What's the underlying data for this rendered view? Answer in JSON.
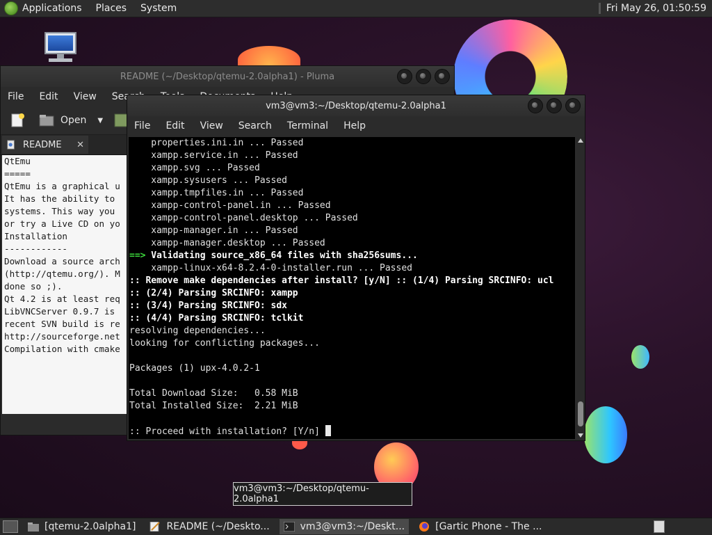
{
  "top_panel": {
    "menus": [
      "Applications",
      "Places",
      "System"
    ],
    "clock": "Fri May 26, 01:50:59"
  },
  "pluma": {
    "title": "README (~/Desktop/qtemu-2.0alpha1) - Pluma",
    "menus": [
      "File",
      "Edit",
      "View",
      "Search",
      "Tools",
      "Documents",
      "Help"
    ],
    "toolbar": {
      "open_label": "Open"
    },
    "tab_label": "README",
    "text_lines": [
      "QtEmu",
      "=====",
      "",
      "QtEmu is a graphical u",
      "It has the ability to",
      "systems. This way you",
      "or try a Live CD on yo",
      "",
      "Installation",
      "------------",
      "Download a source arch",
      "(http://qtemu.org/). M",
      "done so ;).",
      "",
      "Qt 4.2 is at least req",
      "",
      "LibVNCServer 0.9.7 is",
      "recent SVN build is re",
      "http://sourceforge.net",
      "",
      "Compilation with cmake"
    ]
  },
  "terminal": {
    "title": "vm3@vm3:~/Desktop/qtemu-2.0alpha1",
    "menus": [
      "File",
      "Edit",
      "View",
      "Search",
      "Terminal",
      "Help"
    ],
    "lines": [
      {
        "prefix": "",
        "text": "    properties.ini.in ... Passed",
        "bold": false
      },
      {
        "prefix": "",
        "text": "    xampp.service.in ... Passed",
        "bold": false
      },
      {
        "prefix": "",
        "text": "    xampp.svg ... Passed",
        "bold": false
      },
      {
        "prefix": "",
        "text": "    xampp.sysusers ... Passed",
        "bold": false
      },
      {
        "prefix": "",
        "text": "    xampp.tmpfiles.in ... Passed",
        "bold": false
      },
      {
        "prefix": "",
        "text": "    xampp-control-panel.in ... Passed",
        "bold": false
      },
      {
        "prefix": "",
        "text": "    xampp-control-panel.desktop ... Passed",
        "bold": false
      },
      {
        "prefix": "",
        "text": "    xampp-manager.in ... Passed",
        "bold": false
      },
      {
        "prefix": "",
        "text": "    xampp-manager.desktop ... Passed",
        "bold": false
      },
      {
        "prefix": "==>",
        "text": " Validating source_x86_64 files with sha256sums...",
        "bold": true
      },
      {
        "prefix": "",
        "text": "    xampp-linux-x64-8.2.4-0-installer.run ... Passed",
        "bold": false
      },
      {
        "prefix": "",
        "text": ":: Remove make dependencies after install? [y/N] :: (1/4) Parsing SRCINFO: ucl",
        "bold": true
      },
      {
        "prefix": "",
        "text": ":: (2/4) Parsing SRCINFO: xampp",
        "bold": true
      },
      {
        "prefix": "",
        "text": ":: (3/4) Parsing SRCINFO: sdx",
        "bold": true
      },
      {
        "prefix": "",
        "text": ":: (4/4) Parsing SRCINFO: tclkit",
        "bold": true
      },
      {
        "prefix": "",
        "text": "resolving dependencies...",
        "bold": false
      },
      {
        "prefix": "",
        "text": "looking for conflicting packages...",
        "bold": false
      },
      {
        "prefix": "",
        "text": "",
        "bold": false
      },
      {
        "prefix": "",
        "text": "Packages (1) upx-4.0.2-1",
        "bold": false
      },
      {
        "prefix": "",
        "text": "",
        "bold": false
      },
      {
        "prefix": "",
        "text": "Total Download Size:   0.58 MiB",
        "bold": false
      },
      {
        "prefix": "",
        "text": "Total Installed Size:  2.21 MiB",
        "bold": false
      },
      {
        "prefix": "",
        "text": "",
        "bold": false
      },
      {
        "prefix": "",
        "text": ":: Proceed with installation? [Y/n] ",
        "bold": false
      }
    ]
  },
  "tooltip": "vm3@vm3:~/Desktop/qtemu-2.0alpha1",
  "taskbar": {
    "items": [
      {
        "label": "[qtemu-2.0alpha1]",
        "icon": "folder-icon"
      },
      {
        "label": "README (~/Deskto...",
        "icon": "text-editor-icon"
      },
      {
        "label": "vm3@vm3:~/Deskt...",
        "icon": "terminal-icon"
      },
      {
        "label": "[Gartic Phone - The ...",
        "icon": "firefox-icon"
      }
    ]
  }
}
